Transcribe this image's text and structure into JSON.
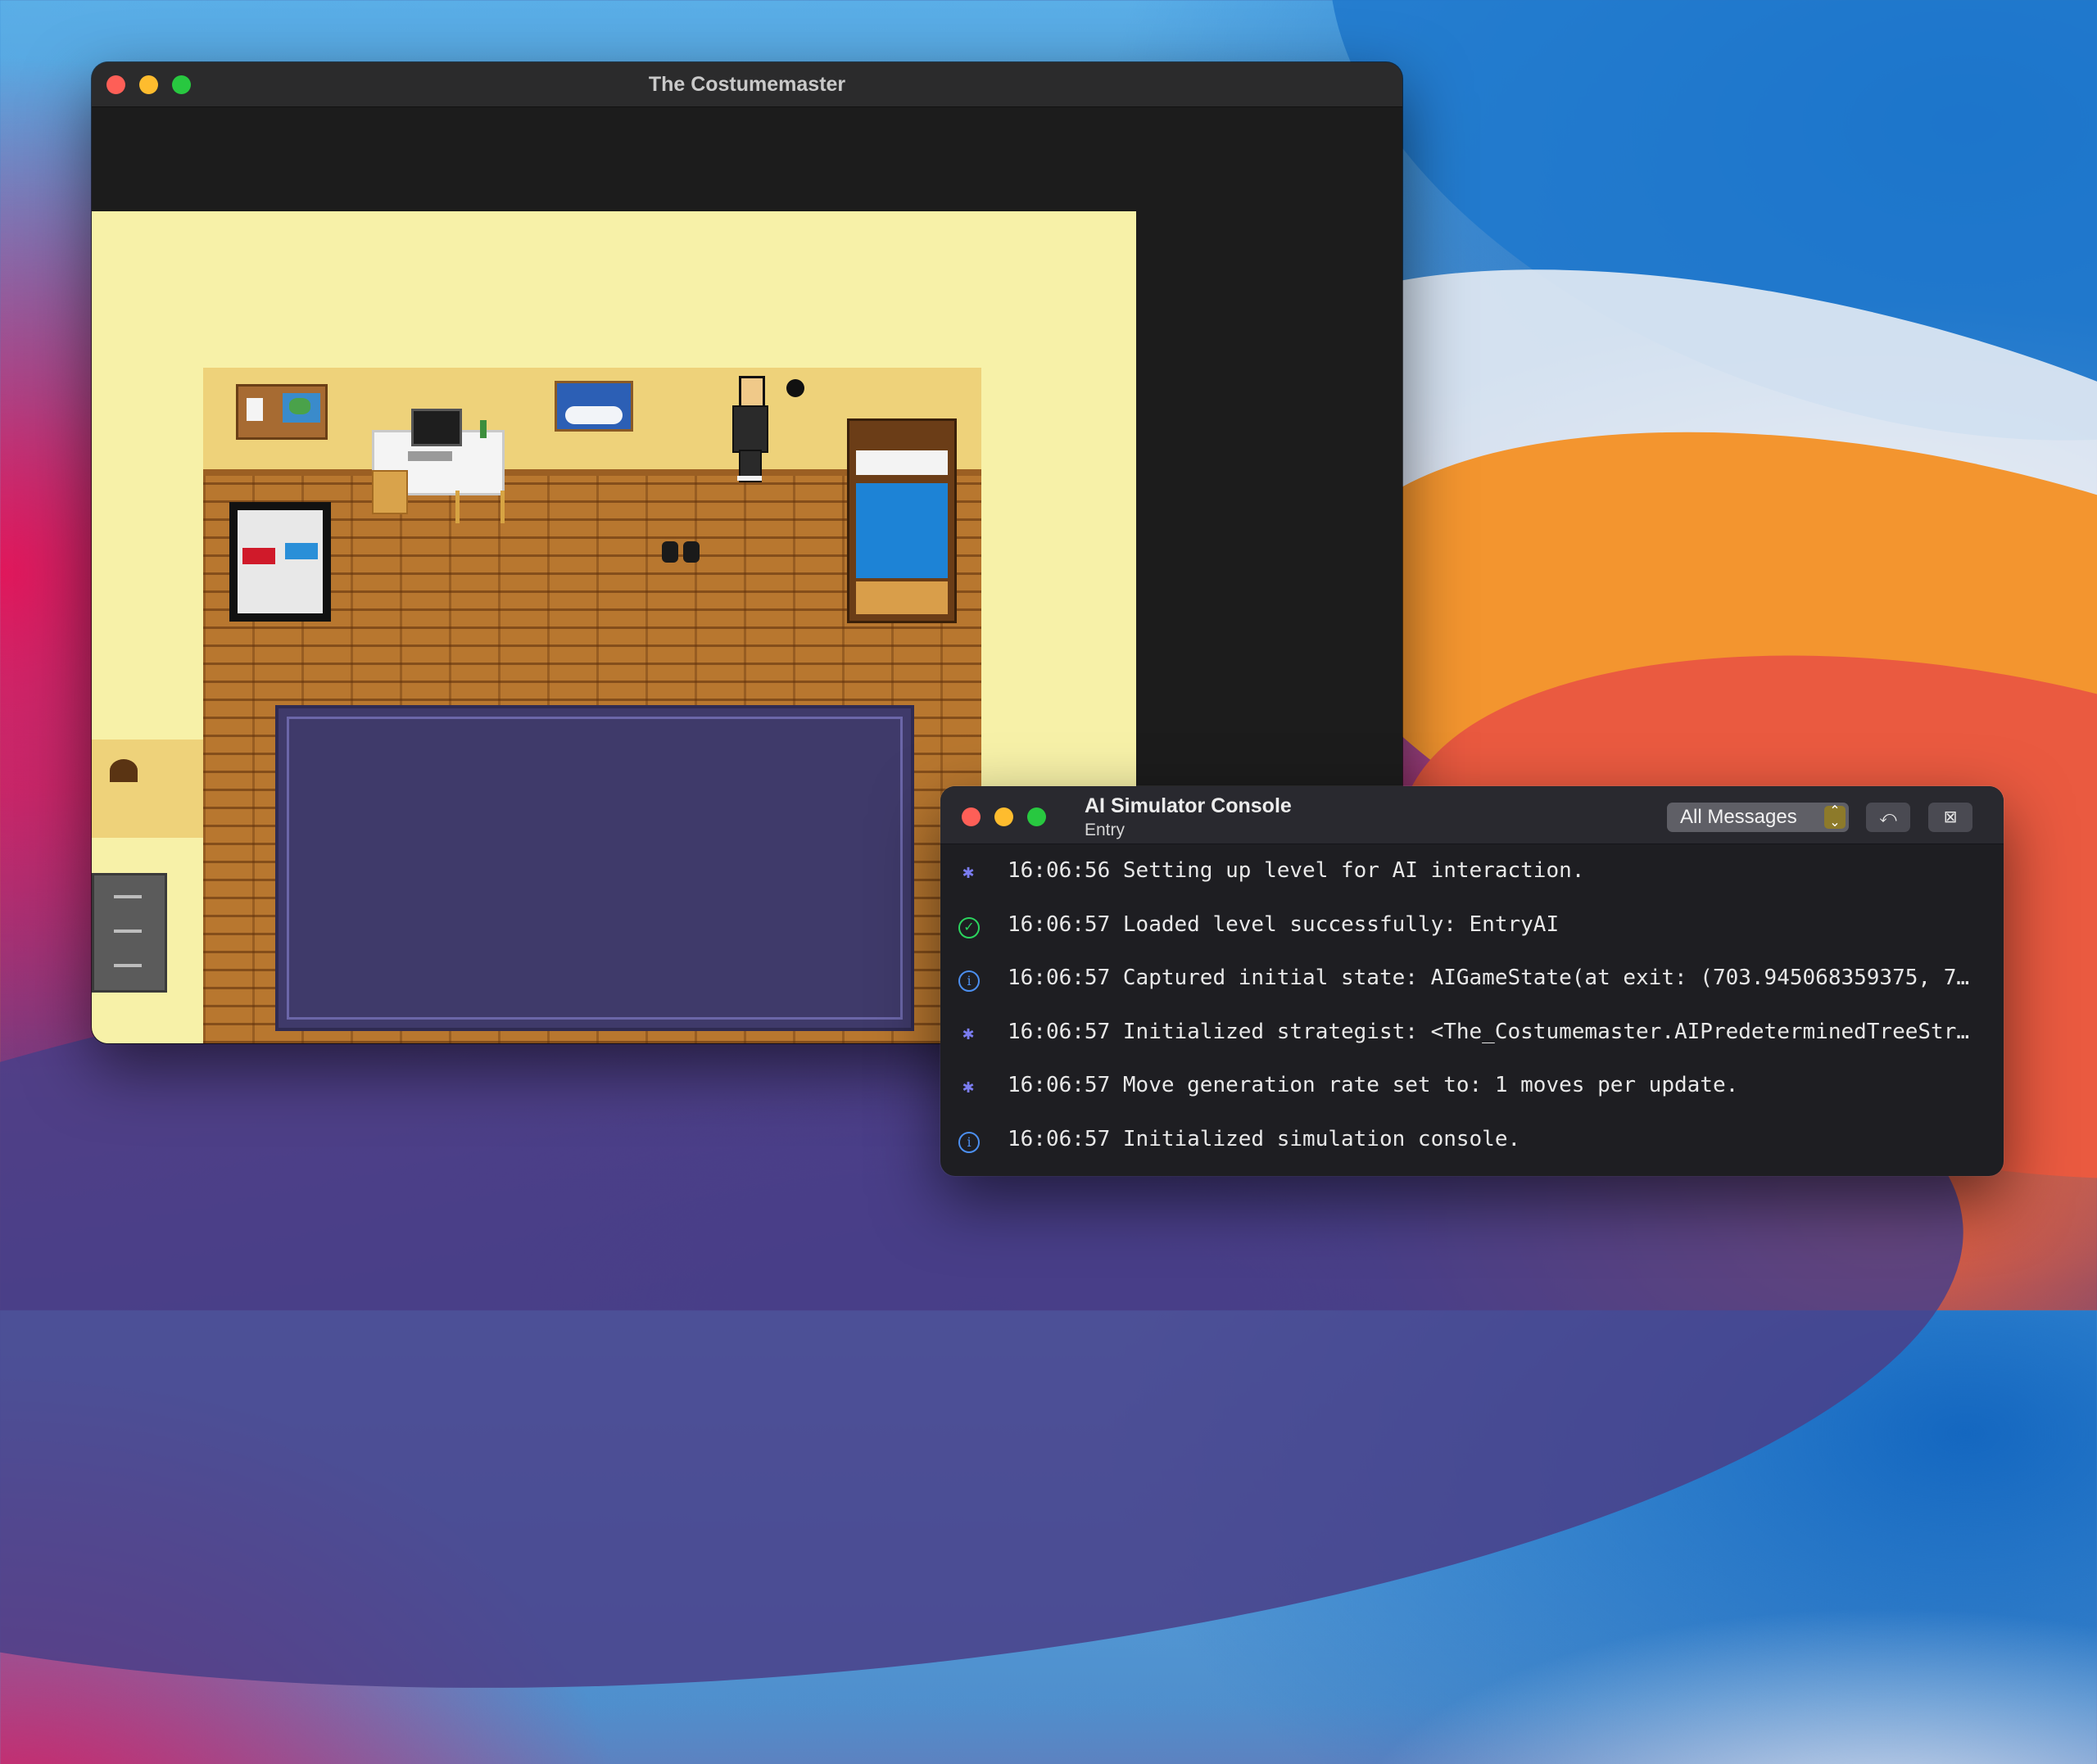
{
  "game_window": {
    "title": "The Costumemaster"
  },
  "console": {
    "title": "AI Simulator Console",
    "subtitle": "Entry",
    "filter": {
      "selected": "All Messages"
    },
    "messages": [
      {
        "icon": "bug-icon",
        "time": "16:06:56",
        "text": "Setting up level for AI interaction."
      },
      {
        "icon": "checkmark-icon",
        "time": "16:06:57",
        "text": "Loaded level successfully: EntryAI"
      },
      {
        "icon": "info-icon",
        "time": "16:06:57",
        "text": "Captured initial state: AIGameState(at exit: (703.945068359375, 7…"
      },
      {
        "icon": "bug-icon",
        "time": "16:06:57",
        "text": "Initialized strategist: <The_Costumemaster.AIPredeterminedTreeStr…"
      },
      {
        "icon": "bug-icon",
        "time": "16:06:57",
        "text": "Move generation rate set to: 1 moves per update."
      },
      {
        "icon": "info-icon",
        "time": "16:06:57",
        "text": "Initialized simulation console."
      }
    ]
  },
  "colors": {
    "close": "#fe5f57",
    "minimize": "#febc2e",
    "zoom": "#28c840",
    "bug_icon": "#7a7cf0",
    "success_icon": "#2bd45e",
    "info_icon": "#4c8ff0"
  }
}
